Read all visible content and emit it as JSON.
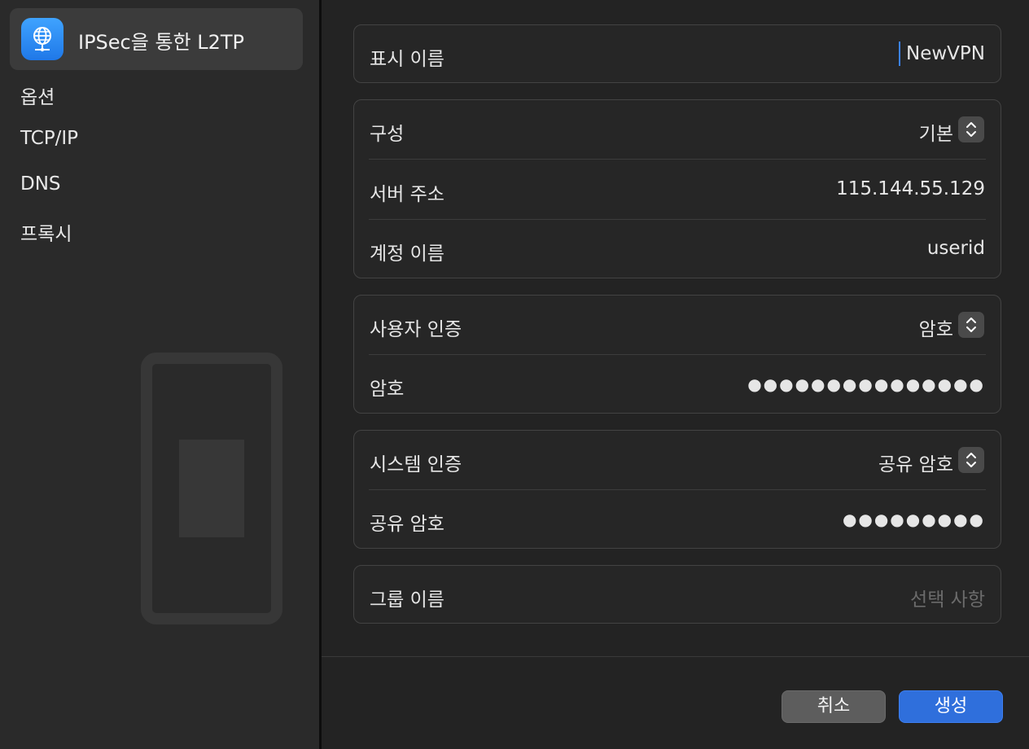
{
  "sidebar": {
    "selected_item": {
      "label": "IPSec을 통한 L2TP",
      "icon": "globe-network-icon"
    },
    "items": [
      {
        "label": "옵션"
      },
      {
        "label": "TCP/IP"
      },
      {
        "label": "DNS"
      },
      {
        "label": "프록시"
      }
    ]
  },
  "form": {
    "display_name": {
      "label": "표시 이름",
      "value": "NewVPN"
    },
    "configuration": {
      "label": "구성",
      "value": "기본"
    },
    "server_address": {
      "label": "서버 주소",
      "value": "115.144.55.129"
    },
    "account_name": {
      "label": "계정 이름",
      "value": "userid"
    },
    "user_auth": {
      "label": "사용자 인증",
      "value": "암호"
    },
    "password": {
      "label": "암호",
      "value": "●●●●●●●●●●●●●●●"
    },
    "machine_auth": {
      "label": "시스템 인증",
      "value": "공유 암호"
    },
    "shared_secret": {
      "label": "공유 암호",
      "value": "●●●●●●●●●"
    },
    "group_name": {
      "label": "그룹 이름",
      "placeholder": "선택 사항"
    }
  },
  "buttons": {
    "cancel": "취소",
    "create": "생성"
  },
  "colors": {
    "accent": "#2f6fdc",
    "background": "#232323",
    "sidebar": "#2a2a2a"
  }
}
